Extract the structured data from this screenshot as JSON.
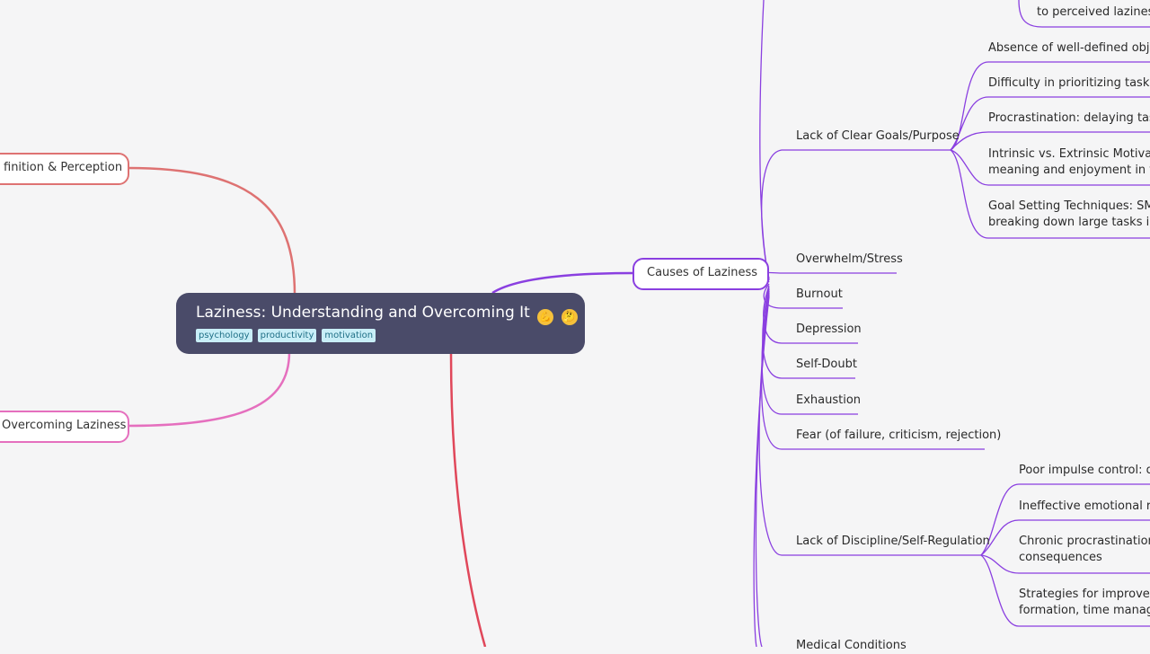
{
  "root": {
    "title": "Laziness: Understanding and Overcoming It",
    "emoji": [
      "💪",
      "🤔"
    ],
    "tags": [
      "psychology",
      "productivity",
      "motivation"
    ]
  },
  "left_branches": {
    "definition": "finition & Perception",
    "overcoming": "Overcoming Laziness"
  },
  "causes": {
    "label": "Causes of Laziness",
    "top_partial": "to perceived laziness",
    "goals": {
      "label": "Lack of Clear Goals/Purpose",
      "items": [
        "Absence of well-defined objec",
        "Difficulty in prioritizing tasks: i",
        "Procrastination: delaying tasks",
        "Intrinsic vs. Extrinsic Motivatio",
        "meaning and enjoyment in tas",
        "Goal Setting Techniques: SMAI",
        "breaking down large tasks into"
      ]
    },
    "simple_items": [
      "Overwhelm/Stress",
      "Burnout",
      "Depression",
      "Self-Doubt",
      "Exhaustion",
      "Fear (of failure, criticism, rejection)"
    ],
    "discipline": {
      "label": "Lack of Discipline/Self-Regulation",
      "items": [
        "Poor impulse control: dif",
        "Ineffective emotional reg",
        "Chronic procrastination:",
        "consequences",
        "Strategies for improveme",
        "formation, time manage"
      ]
    },
    "medical": "Medical Conditions"
  },
  "colors": {
    "purple": "#8a3fe0",
    "red": "#e0475a",
    "salmon": "#de7272",
    "pink": "#e56fbe",
    "root_bg": "#4a4b69",
    "tag_bg": "#c8eef7"
  }
}
